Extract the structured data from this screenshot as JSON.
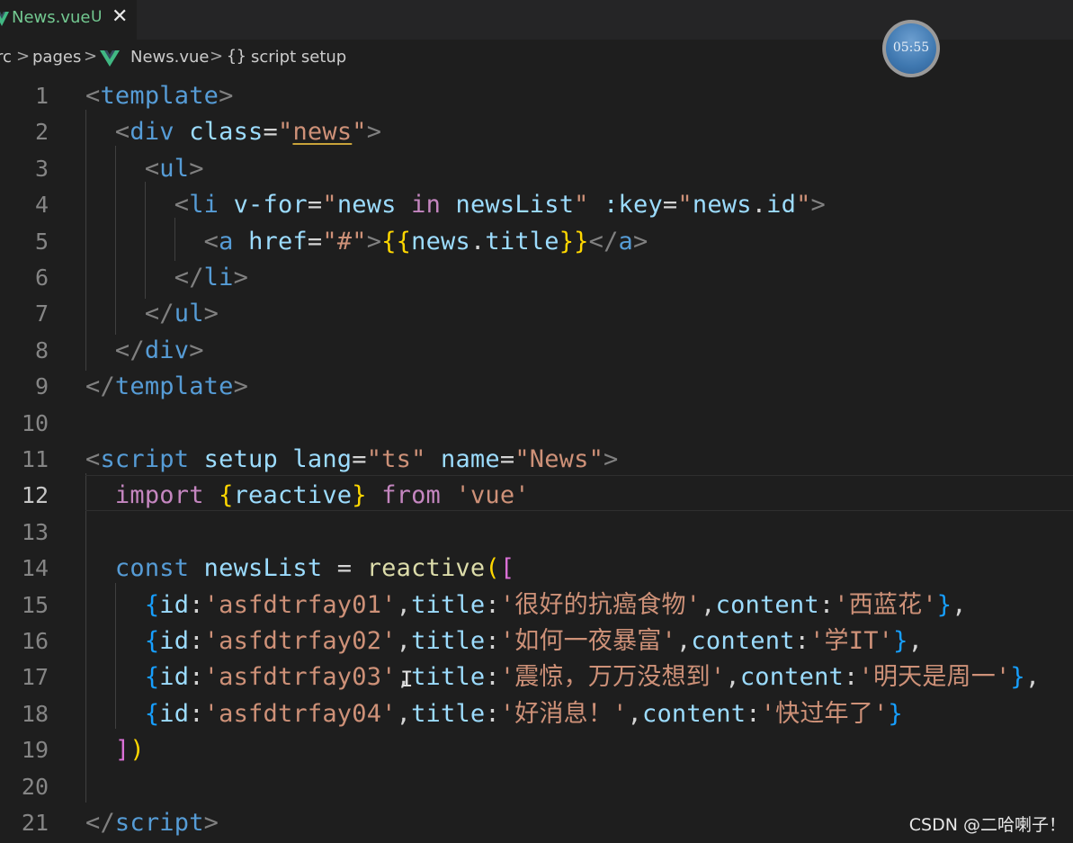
{
  "tab": {
    "title": "News.vue",
    "badge": "U",
    "close_glyph": "✕",
    "icon": "vue-icon"
  },
  "breadcrumb": {
    "items": [
      "rc",
      "pages",
      "News.vue",
      "script setup"
    ],
    "separator": ">",
    "braces": "{}",
    "icons": [
      "chevron-right-icon",
      "vue-icon",
      "braces-icon"
    ]
  },
  "clock": {
    "time": "05:55"
  },
  "editor": {
    "active_line": "12",
    "line_numbers": [
      "1",
      "2",
      "3",
      "4",
      "5",
      "6",
      "7",
      "8",
      "9",
      "10",
      "11",
      "12",
      "13",
      "14",
      "15",
      "16",
      "17",
      "18",
      "19",
      "20",
      "21"
    ],
    "lines": [
      [
        [
          "t-punc",
          "<"
        ],
        [
          "t-tag",
          "template"
        ],
        [
          "t-punc",
          ">"
        ]
      ],
      [
        [
          "t-text",
          "  "
        ],
        [
          "t-punc",
          "<"
        ],
        [
          "t-tag",
          "div"
        ],
        [
          "t-text",
          " "
        ],
        [
          "t-attr",
          "class"
        ],
        [
          "t-text",
          "="
        ],
        [
          "t-str",
          "\""
        ],
        [
          "t-str u-warn",
          "news"
        ],
        [
          "t-str",
          "\""
        ],
        [
          "t-punc",
          ">"
        ]
      ],
      [
        [
          "t-text",
          "    "
        ],
        [
          "t-punc",
          "<"
        ],
        [
          "t-tag",
          "ul"
        ],
        [
          "t-punc",
          ">"
        ]
      ],
      [
        [
          "t-text",
          "      "
        ],
        [
          "t-punc",
          "<"
        ],
        [
          "t-tag",
          "li"
        ],
        [
          "t-text",
          " "
        ],
        [
          "t-attr",
          "v-for"
        ],
        [
          "t-text",
          "="
        ],
        [
          "t-str",
          "\""
        ],
        [
          "t-var",
          "news"
        ],
        [
          "t-text",
          " "
        ],
        [
          "t-kw",
          "in"
        ],
        [
          "t-text",
          " "
        ],
        [
          "t-var",
          "newsList"
        ],
        [
          "t-str",
          "\""
        ],
        [
          "t-text",
          " "
        ],
        [
          "t-attr",
          ":key"
        ],
        [
          "t-text",
          "="
        ],
        [
          "t-str",
          "\""
        ],
        [
          "t-var",
          "news"
        ],
        [
          "t-text",
          "."
        ],
        [
          "t-var",
          "id"
        ],
        [
          "t-str",
          "\""
        ],
        [
          "t-punc",
          ">"
        ]
      ],
      [
        [
          "t-text",
          "        "
        ],
        [
          "t-punc",
          "<"
        ],
        [
          "t-tag",
          "a"
        ],
        [
          "t-text",
          " "
        ],
        [
          "t-attr",
          "href"
        ],
        [
          "t-text",
          "="
        ],
        [
          "t-str",
          "\"#\""
        ],
        [
          "t-punc",
          ">"
        ],
        [
          "t-br1",
          "{{"
        ],
        [
          "t-var",
          "news"
        ],
        [
          "t-text",
          "."
        ],
        [
          "t-var",
          "title"
        ],
        [
          "t-br1",
          "}}"
        ],
        [
          "t-punc",
          "</"
        ],
        [
          "t-tag",
          "a"
        ],
        [
          "t-punc",
          ">"
        ]
      ],
      [
        [
          "t-text",
          "      "
        ],
        [
          "t-punc",
          "</"
        ],
        [
          "t-tag",
          "li"
        ],
        [
          "t-punc",
          ">"
        ]
      ],
      [
        [
          "t-text",
          "    "
        ],
        [
          "t-punc",
          "</"
        ],
        [
          "t-tag",
          "ul"
        ],
        [
          "t-punc",
          ">"
        ]
      ],
      [
        [
          "t-text",
          "  "
        ],
        [
          "t-punc",
          "</"
        ],
        [
          "t-tag",
          "div"
        ],
        [
          "t-punc",
          ">"
        ]
      ],
      [
        [
          "t-punc",
          "</"
        ],
        [
          "t-tag",
          "template"
        ],
        [
          "t-punc",
          ">"
        ]
      ],
      [],
      [
        [
          "t-punc",
          "<"
        ],
        [
          "t-tag",
          "script"
        ],
        [
          "t-text",
          " "
        ],
        [
          "t-attr",
          "setup"
        ],
        [
          "t-text",
          " "
        ],
        [
          "t-attr",
          "lang"
        ],
        [
          "t-text",
          "="
        ],
        [
          "t-str",
          "\"ts\""
        ],
        [
          "t-text",
          " "
        ],
        [
          "t-attr",
          "name"
        ],
        [
          "t-text",
          "="
        ],
        [
          "t-str",
          "\"News\""
        ],
        [
          "t-punc",
          ">"
        ]
      ],
      [
        [
          "t-text",
          "  "
        ],
        [
          "t-kw",
          "import"
        ],
        [
          "t-text",
          " "
        ],
        [
          "t-br1",
          "{"
        ],
        [
          "t-var",
          "reactive"
        ],
        [
          "t-br1",
          "}"
        ],
        [
          "t-text",
          " "
        ],
        [
          "t-kw",
          "from"
        ],
        [
          "t-text",
          " "
        ],
        [
          "t-str",
          "'vue'"
        ]
      ],
      [],
      [
        [
          "t-text",
          "  "
        ],
        [
          "t-key",
          "const"
        ],
        [
          "t-text",
          " "
        ],
        [
          "t-var",
          "newsList"
        ],
        [
          "t-text",
          " = "
        ],
        [
          "t-fn",
          "reactive"
        ],
        [
          "t-br1",
          "("
        ],
        [
          "t-br2",
          "["
        ]
      ],
      [
        [
          "t-text",
          "    "
        ],
        [
          "t-br3",
          "{"
        ],
        [
          "t-var",
          "id"
        ],
        [
          "t-text",
          ":"
        ],
        [
          "t-str",
          "'asfdtrfay01'"
        ],
        [
          "t-text",
          ","
        ],
        [
          "t-var",
          "title"
        ],
        [
          "t-text",
          ":"
        ],
        [
          "t-str",
          "'很好的抗癌食物'"
        ],
        [
          "t-text",
          ","
        ],
        [
          "t-var",
          "content"
        ],
        [
          "t-text",
          ":"
        ],
        [
          "t-str",
          "'西蓝花'"
        ],
        [
          "t-br3",
          "}"
        ],
        [
          "t-text",
          ","
        ]
      ],
      [
        [
          "t-text",
          "    "
        ],
        [
          "t-br3",
          "{"
        ],
        [
          "t-var",
          "id"
        ],
        [
          "t-text",
          ":"
        ],
        [
          "t-str",
          "'asfdtrfay02'"
        ],
        [
          "t-text",
          ","
        ],
        [
          "t-var",
          "title"
        ],
        [
          "t-text",
          ":"
        ],
        [
          "t-str",
          "'如何一夜暴富'"
        ],
        [
          "t-text",
          ","
        ],
        [
          "t-var",
          "content"
        ],
        [
          "t-text",
          ":"
        ],
        [
          "t-str",
          "'学IT'"
        ],
        [
          "t-br3",
          "}"
        ],
        [
          "t-text",
          ","
        ]
      ],
      [
        [
          "t-text",
          "    "
        ],
        [
          "t-br3",
          "{"
        ],
        [
          "t-var",
          "id"
        ],
        [
          "t-text",
          ":"
        ],
        [
          "t-str",
          "'asfdtrfay03'"
        ],
        [
          "t-text",
          ","
        ],
        [
          "t-var",
          "title"
        ],
        [
          "t-text",
          ":"
        ],
        [
          "t-str",
          "'震惊，万万没想到'"
        ],
        [
          "t-text",
          ","
        ],
        [
          "t-var",
          "content"
        ],
        [
          "t-text",
          ":"
        ],
        [
          "t-str",
          "'明天是周一'"
        ],
        [
          "t-br3",
          "}"
        ],
        [
          "t-text",
          ","
        ]
      ],
      [
        [
          "t-text",
          "    "
        ],
        [
          "t-br3",
          "{"
        ],
        [
          "t-var",
          "id"
        ],
        [
          "t-text",
          ":"
        ],
        [
          "t-str",
          "'asfdtrfay04'"
        ],
        [
          "t-text",
          ","
        ],
        [
          "t-var",
          "title"
        ],
        [
          "t-text",
          ":"
        ],
        [
          "t-str",
          "'好消息！'"
        ],
        [
          "t-text",
          ","
        ],
        [
          "t-var",
          "content"
        ],
        [
          "t-text",
          ":"
        ],
        [
          "t-str",
          "'快过年了'"
        ],
        [
          "t-br3",
          "}"
        ]
      ],
      [
        [
          "t-text",
          "  "
        ],
        [
          "t-br2",
          "]"
        ],
        [
          "t-br1",
          ")"
        ]
      ],
      [],
      [
        [
          "t-punc",
          "</"
        ],
        [
          "t-tag",
          "script"
        ],
        [
          "t-punc",
          ">"
        ]
      ]
    ]
  },
  "watermark": "CSDN @二哈喇子！",
  "colors": {
    "background": "#1e1e1e",
    "tag": "#569cd6",
    "attribute": "#9cdcfe",
    "string": "#ce9178",
    "keyword": "#c586c0",
    "function": "#dcdcaa",
    "untracked": "#73c991"
  }
}
